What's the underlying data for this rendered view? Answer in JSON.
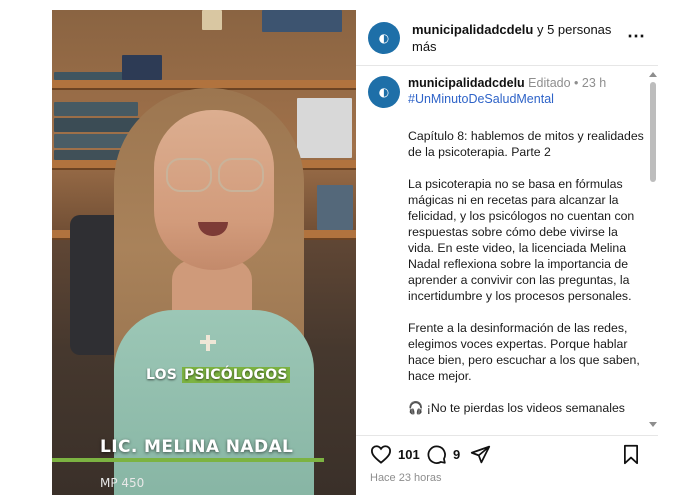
{
  "video": {
    "caption_prefix": "LOS ",
    "caption_highlight": "PSICÓLOGOS",
    "name": "LIC. MELINA NADAL",
    "license": "MP 450"
  },
  "header": {
    "username": "municipalidadcdelu",
    "others": " y 5 personas más",
    "more_icon": "⋯"
  },
  "post": {
    "username": "municipalidadcdelu",
    "meta": " Editado • 23 h",
    "hashtag": "#UnMinutoDeSaludMental",
    "paragraphs": [
      "Capítulo 8: hablemos de mitos y realidades de la psicoterapia. Parte 2",
      "La psicoterapia no se basa en fórmulas mágicas ni en recetas para alcanzar la felicidad, y los psicólogos no cuentan con respuestas sobre cómo debe vivirse la vida. En este video, la licenciada Melina Nadal reflexiona sobre la importancia de aprender a convivir con las preguntas, la incertidumbre y los procesos personales.",
      "Frente a la desinformación de las redes, elegimos voces expertas. Porque hablar hace bien, pero escuchar a los que saben, hace mejor.",
      "🎧 ¡No te pierdas los videos semanales"
    ]
  },
  "actions": {
    "likes": "101",
    "comments": "9",
    "time": "Hace 23 horas"
  },
  "colors": {
    "accent_green": "#7cb342",
    "hashtag_blue": "#2e63c8",
    "avatar_blue": "#1e6fa8"
  }
}
